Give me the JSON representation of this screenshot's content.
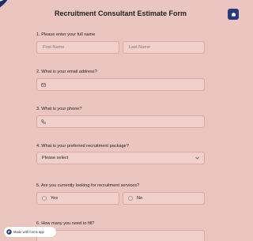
{
  "form": {
    "title": "Recruitment Consultant Estimate Form"
  },
  "questions": {
    "q1": {
      "label": "1.  Please enter your full name",
      "first_placeholder": "First Name",
      "last_placeholder": "Last Name"
    },
    "q2": {
      "label": "2.  What is your email address?"
    },
    "q3": {
      "label": "3.  What is your phone?"
    },
    "q4": {
      "label": "4.  What is your preferred recruitment package?",
      "selected": "Please select"
    },
    "q5": {
      "label": "5.  Are you currently looking for recruitment services?",
      "options": [
        "Yes",
        "No"
      ]
    },
    "q6": {
      "label": "6.  How many you need to fill?"
    }
  },
  "footer": {
    "made_with": "Made with forms app"
  },
  "colors": {
    "background": "#ebc6c1",
    "field": "#f1cfcb",
    "accent": "#29397a"
  },
  "icons": [
    "logo-icon",
    "settings-icon",
    "email-icon",
    "phone-icon",
    "chevron-down-icon",
    "forms-app-icon"
  ]
}
